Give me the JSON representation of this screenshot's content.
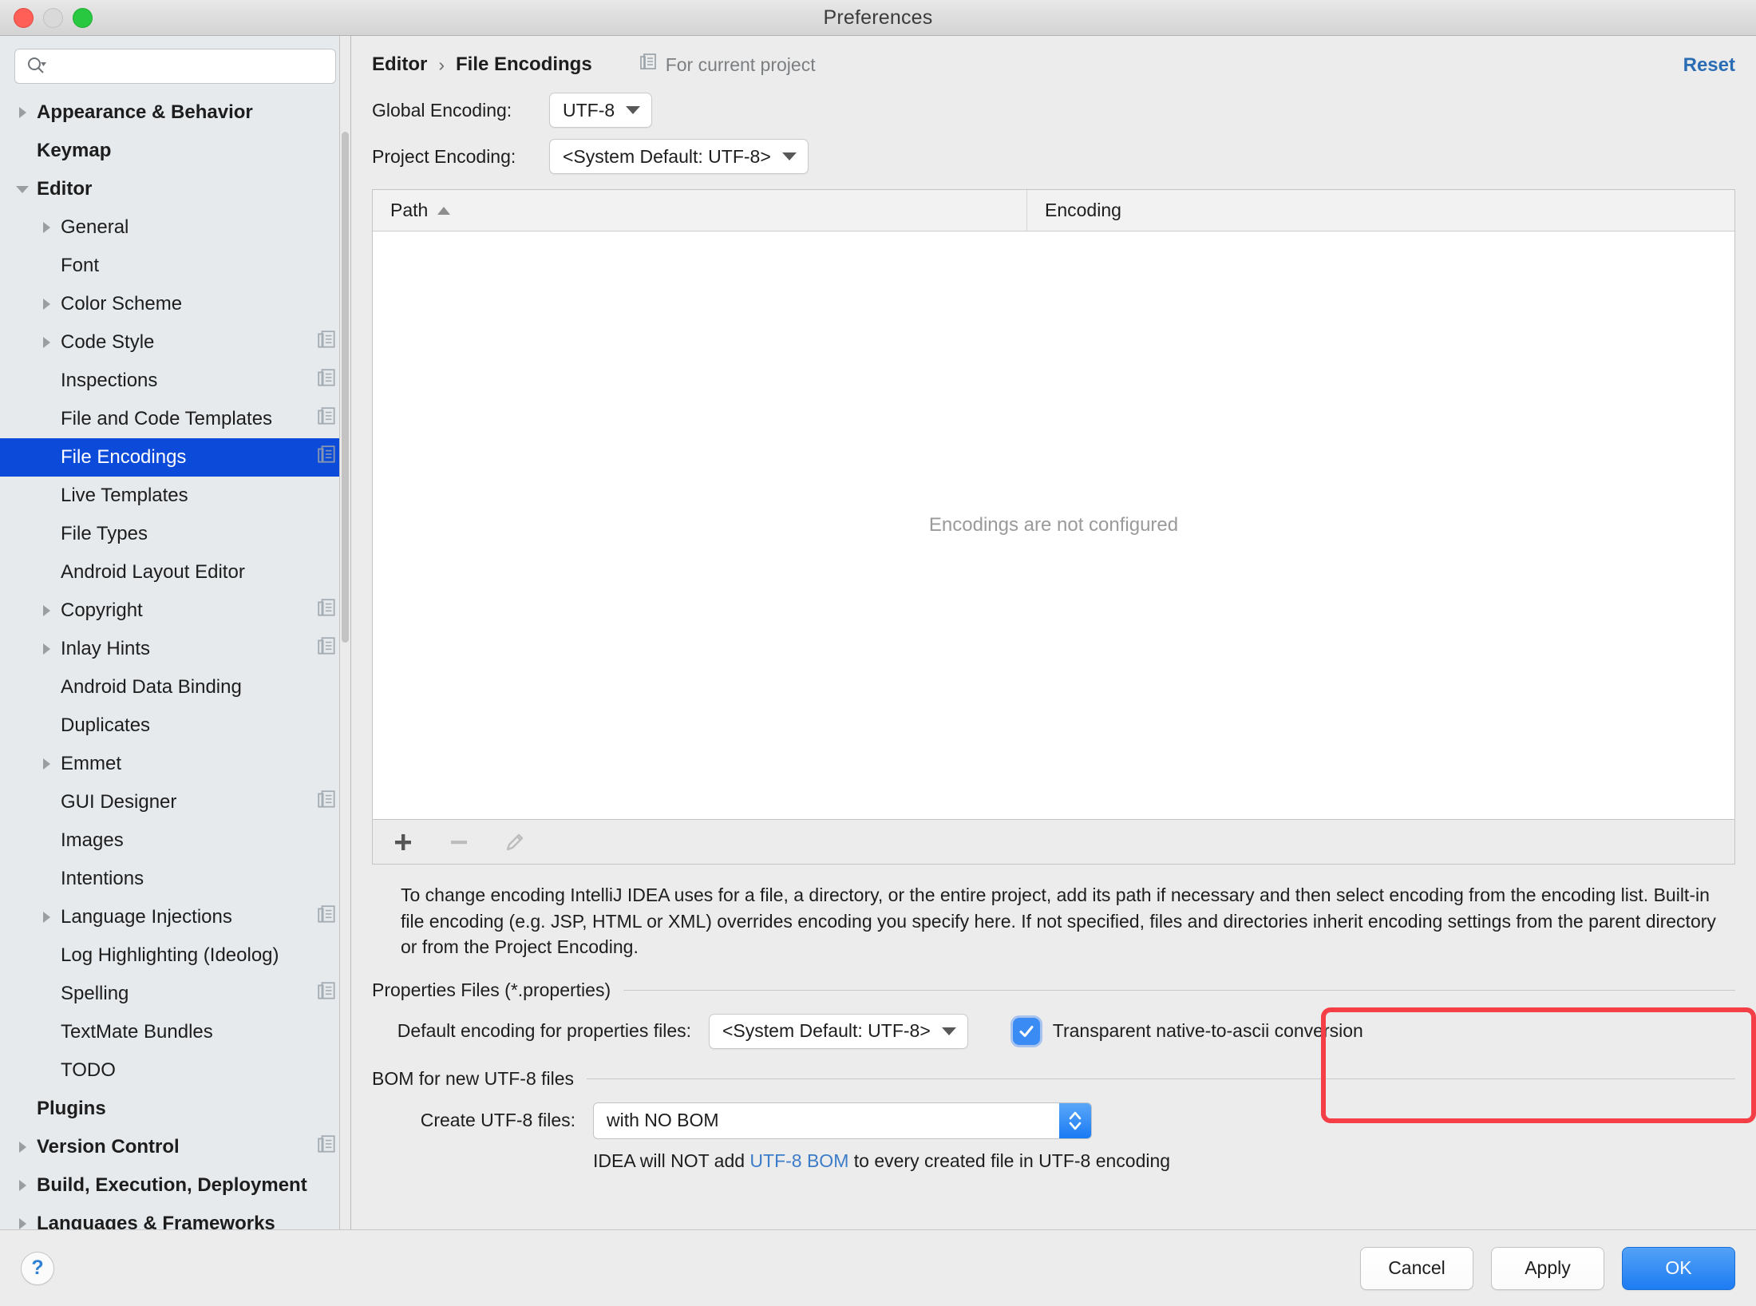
{
  "window": {
    "title": "Preferences"
  },
  "search": {
    "value": "",
    "placeholder": ""
  },
  "sidebar": {
    "items": [
      {
        "label": "Appearance & Behavior",
        "level": 0,
        "bold": true,
        "arrow": "right",
        "copy": false,
        "selected": false
      },
      {
        "label": "Keymap",
        "level": 0,
        "bold": true,
        "arrow": "none",
        "copy": false,
        "selected": false
      },
      {
        "label": "Editor",
        "level": 0,
        "bold": true,
        "arrow": "down",
        "copy": false,
        "selected": false
      },
      {
        "label": "General",
        "level": 1,
        "bold": false,
        "arrow": "right",
        "copy": false,
        "selected": false
      },
      {
        "label": "Font",
        "level": 1,
        "bold": false,
        "arrow": "none",
        "copy": false,
        "selected": false
      },
      {
        "label": "Color Scheme",
        "level": 1,
        "bold": false,
        "arrow": "right",
        "copy": false,
        "selected": false
      },
      {
        "label": "Code Style",
        "level": 1,
        "bold": false,
        "arrow": "right",
        "copy": true,
        "selected": false
      },
      {
        "label": "Inspections",
        "level": 1,
        "bold": false,
        "arrow": "none",
        "copy": true,
        "selected": false
      },
      {
        "label": "File and Code Templates",
        "level": 1,
        "bold": false,
        "arrow": "none",
        "copy": true,
        "selected": false
      },
      {
        "label": "File Encodings",
        "level": 1,
        "bold": false,
        "arrow": "none",
        "copy": true,
        "selected": true
      },
      {
        "label": "Live Templates",
        "level": 1,
        "bold": false,
        "arrow": "none",
        "copy": false,
        "selected": false
      },
      {
        "label": "File Types",
        "level": 1,
        "bold": false,
        "arrow": "none",
        "copy": false,
        "selected": false
      },
      {
        "label": "Android Layout Editor",
        "level": 1,
        "bold": false,
        "arrow": "none",
        "copy": false,
        "selected": false
      },
      {
        "label": "Copyright",
        "level": 1,
        "bold": false,
        "arrow": "right",
        "copy": true,
        "selected": false
      },
      {
        "label": "Inlay Hints",
        "level": 1,
        "bold": false,
        "arrow": "right",
        "copy": true,
        "selected": false
      },
      {
        "label": "Android Data Binding",
        "level": 1,
        "bold": false,
        "arrow": "none",
        "copy": false,
        "selected": false
      },
      {
        "label": "Duplicates",
        "level": 1,
        "bold": false,
        "arrow": "none",
        "copy": false,
        "selected": false
      },
      {
        "label": "Emmet",
        "level": 1,
        "bold": false,
        "arrow": "right",
        "copy": false,
        "selected": false
      },
      {
        "label": "GUI Designer",
        "level": 1,
        "bold": false,
        "arrow": "none",
        "copy": true,
        "selected": false
      },
      {
        "label": "Images",
        "level": 1,
        "bold": false,
        "arrow": "none",
        "copy": false,
        "selected": false
      },
      {
        "label": "Intentions",
        "level": 1,
        "bold": false,
        "arrow": "none",
        "copy": false,
        "selected": false
      },
      {
        "label": "Language Injections",
        "level": 1,
        "bold": false,
        "arrow": "right",
        "copy": true,
        "selected": false
      },
      {
        "label": "Log Highlighting (Ideolog)",
        "level": 1,
        "bold": false,
        "arrow": "none",
        "copy": false,
        "selected": false
      },
      {
        "label": "Spelling",
        "level": 1,
        "bold": false,
        "arrow": "none",
        "copy": true,
        "selected": false
      },
      {
        "label": "TextMate Bundles",
        "level": 1,
        "bold": false,
        "arrow": "none",
        "copy": false,
        "selected": false
      },
      {
        "label": "TODO",
        "level": 1,
        "bold": false,
        "arrow": "none",
        "copy": false,
        "selected": false
      },
      {
        "label": "Plugins",
        "level": 0,
        "bold": true,
        "arrow": "none",
        "copy": false,
        "selected": false
      },
      {
        "label": "Version Control",
        "level": 0,
        "bold": true,
        "arrow": "right",
        "copy": true,
        "selected": false
      },
      {
        "label": "Build, Execution, Deployment",
        "level": 0,
        "bold": true,
        "arrow": "right",
        "copy": false,
        "selected": false
      },
      {
        "label": "Languages & Frameworks",
        "level": 0,
        "bold": true,
        "arrow": "right",
        "copy": false,
        "selected": false
      }
    ]
  },
  "main": {
    "breadcrumb": {
      "parent": "Editor",
      "separator": "›",
      "current": "File Encodings"
    },
    "scope_label": "For current project",
    "reset_label": "Reset",
    "global_encoding": {
      "label": "Global Encoding:",
      "value": "UTF-8"
    },
    "project_encoding": {
      "label": "Project Encoding:",
      "value": "<System Default: UTF-8>"
    },
    "table": {
      "columns": [
        "Path",
        "Encoding"
      ],
      "sort_column": "Path",
      "sort_direction": "ascending",
      "rows": [],
      "empty_message": "Encodings are not configured"
    },
    "toolbar": {
      "add": "+",
      "remove": "−",
      "edit": "pencil"
    },
    "description": "To change encoding IntelliJ IDEA uses for a file, a directory, or the entire project, add its path if necessary and then select encoding from the encoding list. Built-in file encoding (e.g. JSP, HTML or XML) overrides encoding you specify here. If not specified, files and directories inherit encoding settings from the parent directory or from the Project Encoding.",
    "properties_section": {
      "title": "Properties Files (*.properties)",
      "default_encoding_label": "Default encoding for properties files:",
      "default_encoding_value": "<System Default: UTF-8>",
      "transparent_label": "Transparent native-to-ascii conversion",
      "transparent_checked": true
    },
    "bom_section": {
      "title": "BOM for new UTF-8 files",
      "create_label": "Create UTF-8 files:",
      "create_value": "with NO BOM",
      "hint_prefix": "IDEA will NOT add ",
      "hint_link": "UTF-8 BOM",
      "hint_suffix": " to every created file in UTF-8 encoding"
    }
  },
  "footer": {
    "help_label": "?",
    "cancel_label": "Cancel",
    "apply_label": "Apply",
    "ok_label": "OK"
  },
  "colors": {
    "selection_blue": "#0C4BD9",
    "accent_blue": "#2A6DB5",
    "highlight_red": "#F43F46",
    "primary_button": "#1D7CF2",
    "sidebar_bg": "#E6EAED",
    "panel_bg": "#ECECEC"
  }
}
